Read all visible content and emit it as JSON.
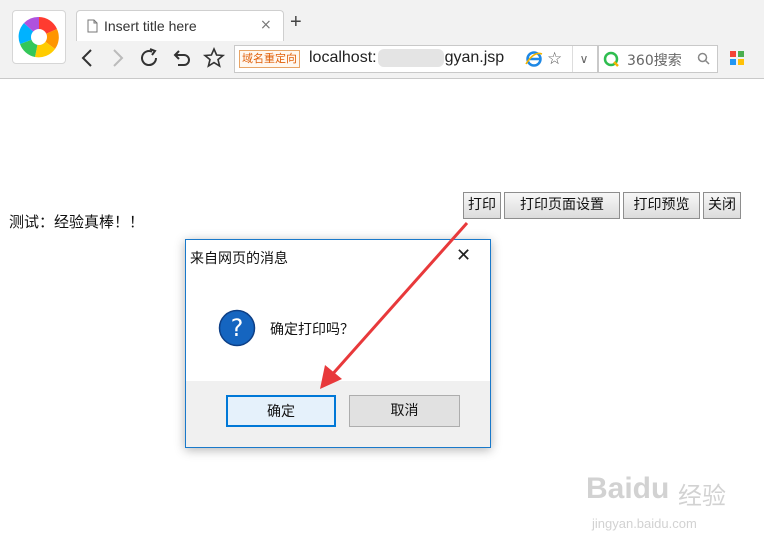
{
  "browser": {
    "tab_title": "Insert title here",
    "tab_close": "×",
    "new_tab": "+",
    "redirect_badge": "域名重定向",
    "url_host": "localhost:",
    "url_path": "gyan.jsp",
    "address_dropdown": "∨",
    "search_placeholder": "360搜索"
  },
  "page": {
    "text": "测试：经验真棒！！",
    "buttons": [
      {
        "label": "打印"
      },
      {
        "label": "打印页面设置"
      },
      {
        "label": "打印预览"
      },
      {
        "label": "关闭"
      }
    ]
  },
  "dialog": {
    "title": "来自网页的消息",
    "close": "✕",
    "message": "确定打印吗？",
    "ok_label": "确定",
    "cancel_label": "取消"
  },
  "watermark": {
    "brand": "Baidu",
    "suffix": "经验",
    "url": "jingyan.baidu.com"
  },
  "colors": {
    "dialog_border": "#1979ca",
    "ok_border": "#0078d7",
    "arrow": "#e8393b",
    "question_icon": "#1565c0"
  },
  "icons": [
    "browser-logo-icon",
    "document-icon",
    "back-icon",
    "forward-icon",
    "refresh-icon",
    "undo-icon",
    "star-icon",
    "ie-icon",
    "search-engine-icon",
    "magnifier-icon",
    "apps-icon",
    "question-icon",
    "close-icon"
  ]
}
